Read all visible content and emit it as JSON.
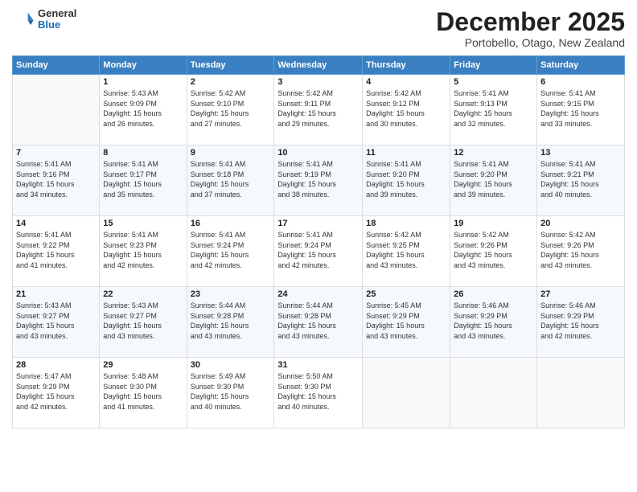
{
  "logo": {
    "general": "General",
    "blue": "Blue"
  },
  "header": {
    "month": "December 2025",
    "location": "Portobello, Otago, New Zealand"
  },
  "weekdays": [
    "Sunday",
    "Monday",
    "Tuesday",
    "Wednesday",
    "Thursday",
    "Friday",
    "Saturday"
  ],
  "weeks": [
    [
      {
        "day": "",
        "info": ""
      },
      {
        "day": "1",
        "info": "Sunrise: 5:43 AM\nSunset: 9:09 PM\nDaylight: 15 hours\nand 26 minutes."
      },
      {
        "day": "2",
        "info": "Sunrise: 5:42 AM\nSunset: 9:10 PM\nDaylight: 15 hours\nand 27 minutes."
      },
      {
        "day": "3",
        "info": "Sunrise: 5:42 AM\nSunset: 9:11 PM\nDaylight: 15 hours\nand 29 minutes."
      },
      {
        "day": "4",
        "info": "Sunrise: 5:42 AM\nSunset: 9:12 PM\nDaylight: 15 hours\nand 30 minutes."
      },
      {
        "day": "5",
        "info": "Sunrise: 5:41 AM\nSunset: 9:13 PM\nDaylight: 15 hours\nand 32 minutes."
      },
      {
        "day": "6",
        "info": "Sunrise: 5:41 AM\nSunset: 9:15 PM\nDaylight: 15 hours\nand 33 minutes."
      }
    ],
    [
      {
        "day": "7",
        "info": "Sunrise: 5:41 AM\nSunset: 9:16 PM\nDaylight: 15 hours\nand 34 minutes."
      },
      {
        "day": "8",
        "info": "Sunrise: 5:41 AM\nSunset: 9:17 PM\nDaylight: 15 hours\nand 35 minutes."
      },
      {
        "day": "9",
        "info": "Sunrise: 5:41 AM\nSunset: 9:18 PM\nDaylight: 15 hours\nand 37 minutes."
      },
      {
        "day": "10",
        "info": "Sunrise: 5:41 AM\nSunset: 9:19 PM\nDaylight: 15 hours\nand 38 minutes."
      },
      {
        "day": "11",
        "info": "Sunrise: 5:41 AM\nSunset: 9:20 PM\nDaylight: 15 hours\nand 39 minutes."
      },
      {
        "day": "12",
        "info": "Sunrise: 5:41 AM\nSunset: 9:20 PM\nDaylight: 15 hours\nand 39 minutes."
      },
      {
        "day": "13",
        "info": "Sunrise: 5:41 AM\nSunset: 9:21 PM\nDaylight: 15 hours\nand 40 minutes."
      }
    ],
    [
      {
        "day": "14",
        "info": "Sunrise: 5:41 AM\nSunset: 9:22 PM\nDaylight: 15 hours\nand 41 minutes."
      },
      {
        "day": "15",
        "info": "Sunrise: 5:41 AM\nSunset: 9:23 PM\nDaylight: 15 hours\nand 42 minutes."
      },
      {
        "day": "16",
        "info": "Sunrise: 5:41 AM\nSunset: 9:24 PM\nDaylight: 15 hours\nand 42 minutes."
      },
      {
        "day": "17",
        "info": "Sunrise: 5:41 AM\nSunset: 9:24 PM\nDaylight: 15 hours\nand 42 minutes."
      },
      {
        "day": "18",
        "info": "Sunrise: 5:42 AM\nSunset: 9:25 PM\nDaylight: 15 hours\nand 43 minutes."
      },
      {
        "day": "19",
        "info": "Sunrise: 5:42 AM\nSunset: 9:26 PM\nDaylight: 15 hours\nand 43 minutes."
      },
      {
        "day": "20",
        "info": "Sunrise: 5:42 AM\nSunset: 9:26 PM\nDaylight: 15 hours\nand 43 minutes."
      }
    ],
    [
      {
        "day": "21",
        "info": "Sunrise: 5:43 AM\nSunset: 9:27 PM\nDaylight: 15 hours\nand 43 minutes."
      },
      {
        "day": "22",
        "info": "Sunrise: 5:43 AM\nSunset: 9:27 PM\nDaylight: 15 hours\nand 43 minutes."
      },
      {
        "day": "23",
        "info": "Sunrise: 5:44 AM\nSunset: 9:28 PM\nDaylight: 15 hours\nand 43 minutes."
      },
      {
        "day": "24",
        "info": "Sunrise: 5:44 AM\nSunset: 9:28 PM\nDaylight: 15 hours\nand 43 minutes."
      },
      {
        "day": "25",
        "info": "Sunrise: 5:45 AM\nSunset: 9:29 PM\nDaylight: 15 hours\nand 43 minutes."
      },
      {
        "day": "26",
        "info": "Sunrise: 5:46 AM\nSunset: 9:29 PM\nDaylight: 15 hours\nand 43 minutes."
      },
      {
        "day": "27",
        "info": "Sunrise: 5:46 AM\nSunset: 9:29 PM\nDaylight: 15 hours\nand 42 minutes."
      }
    ],
    [
      {
        "day": "28",
        "info": "Sunrise: 5:47 AM\nSunset: 9:29 PM\nDaylight: 15 hours\nand 42 minutes."
      },
      {
        "day": "29",
        "info": "Sunrise: 5:48 AM\nSunset: 9:30 PM\nDaylight: 15 hours\nand 41 minutes."
      },
      {
        "day": "30",
        "info": "Sunrise: 5:49 AM\nSunset: 9:30 PM\nDaylight: 15 hours\nand 40 minutes."
      },
      {
        "day": "31",
        "info": "Sunrise: 5:50 AM\nSunset: 9:30 PM\nDaylight: 15 hours\nand 40 minutes."
      },
      {
        "day": "",
        "info": ""
      },
      {
        "day": "",
        "info": ""
      },
      {
        "day": "",
        "info": ""
      }
    ]
  ]
}
